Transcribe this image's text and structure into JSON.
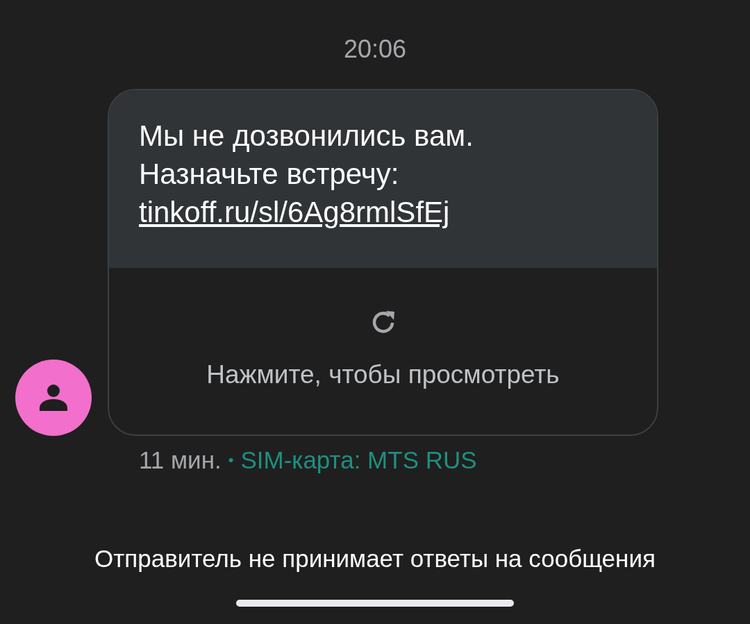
{
  "timestamp": "20:06",
  "message": {
    "text": "Мы не дозвонились вам. Назначьте встречу:",
    "link": "tinkoff.ru/sl/6Ag8rmlSfEj",
    "preview_hint": "Нажмите, чтобы просмотреть"
  },
  "meta": {
    "age": "11 мин.",
    "separator": "•",
    "sim": "SIM-карта: MTS RUS"
  },
  "footer": "Отправитель не принимает ответы на сообщения"
}
